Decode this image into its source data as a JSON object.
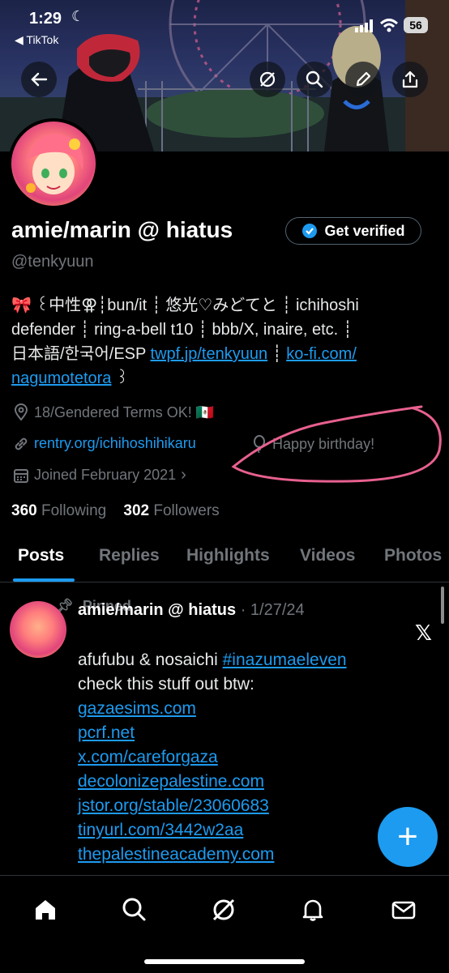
{
  "status_bar": {
    "time": "1:29",
    "back_app": "TikTok",
    "battery": "56"
  },
  "profile": {
    "display_name": "amie/marin @ hiatus",
    "verify_button": "Get verified",
    "handle": "@tenkyuun",
    "bio": {
      "line1": "🎀 ꒰中性⚢┊bun/it ┊ 悠光♡みどてと ┊ ichihoshi",
      "line2": "defender ┊ ring-a-bell t10 ┊ bbb/X, inaire, etc. ┊",
      "line3_text": "日本語/한국어/ESP ",
      "link1": "twpf.jp/tenkyuun",
      "sep": " ┊ ",
      "link2a": "ko-fi.com/",
      "link2b": "nagumotetora",
      "line4_tail": " ꒱"
    },
    "location": "18/Gendered Terms OK! 🇲🇽",
    "website": "rentry.org/ichihoshihikaru",
    "birthday": "Happy birthday!",
    "joined": "Joined February 2021",
    "following_count": "360",
    "following_label": "Following",
    "followers_count": "302",
    "followers_label": "Followers"
  },
  "tabs": [
    "Posts",
    "Replies",
    "Highlights",
    "Videos",
    "Photos"
  ],
  "post": {
    "pinned_label": "Pinned",
    "author": "amie/marin @ hiatus",
    "date": "· 1/27/24",
    "text_a": "afufubu & nosaichi ",
    "hashtag": "#inazumaeleven",
    "text_b": "check this stuff out btw:",
    "links": [
      "gazaesims.com",
      "pcrf.net",
      "x.com/careforgaza",
      "decolonizepalestine.com",
      "jstor.org/stable/23060683",
      "tinyurl.com/3442w2aa",
      "thepalestineacademy.com"
    ]
  },
  "colors": {
    "accent": "#1d9bf0",
    "annotation": "#e8608f"
  }
}
